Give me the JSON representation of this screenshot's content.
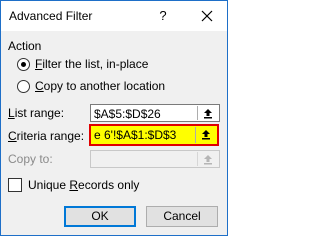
{
  "window": {
    "title": "Advanced Filter",
    "help_label": "?",
    "close_icon": "close-icon"
  },
  "action": {
    "label": "Action",
    "options": [
      {
        "accel": "F",
        "rest": "ilter the list, in-place",
        "selected": true
      },
      {
        "accel": "C",
        "rest": "opy to another location",
        "selected": false
      }
    ]
  },
  "list_range": {
    "accel": "L",
    "rest": "ist range:",
    "value": "$A$5:$D$26"
  },
  "criteria_range": {
    "accel": "C",
    "rest": "riteria range:",
    "value": "e 6'!$A$1:$D$3",
    "highlight_fill": "#ffff00",
    "highlight_border": "#e00000"
  },
  "copy_to": {
    "label": "Copy to:",
    "value": ""
  },
  "unique": {
    "accel": "R",
    "before": "Unique ",
    "after": "ecords only",
    "checked": false
  },
  "buttons": {
    "ok": "OK",
    "cancel": "Cancel"
  },
  "colors": {
    "window_border": "#1e6fc8",
    "dialog_bg": "#f0f0f0",
    "default_button_border": "#0078d7"
  },
  "icons": {
    "collapse": "collapse-dialog-icon"
  }
}
